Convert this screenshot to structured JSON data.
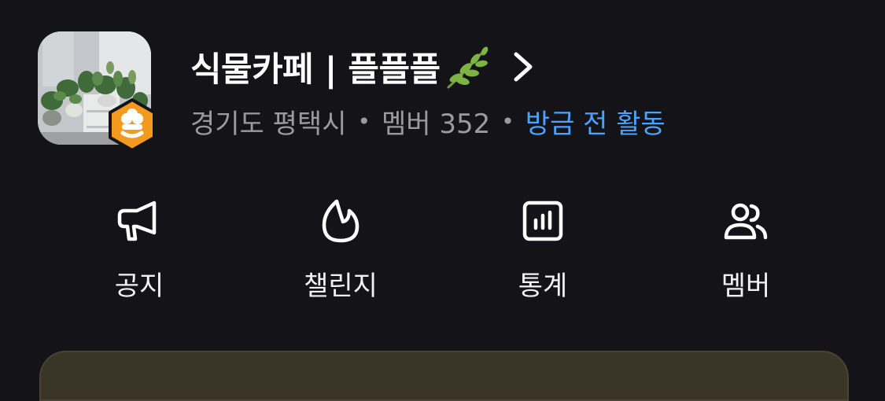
{
  "cafe": {
    "title": "식물카페 | 플플플",
    "location": "경기도 평택시",
    "members": "멤버 352",
    "activity": "방금 전 활동"
  },
  "menu": {
    "notice": "공지",
    "challenge": "챌린지",
    "stats": "통계",
    "members": "멤버"
  },
  "colors": {
    "background": "#141418",
    "accent_blue": "#4aa3ff",
    "badge_orange": "#f39a1e",
    "meta_gray": "#9a9aa0"
  },
  "icons": {
    "title_suffix": "herb-leaf-icon",
    "title_chevron": "chevron-right-icon",
    "badge": "cafe-badge-icon",
    "notice": "megaphone-icon",
    "challenge": "flame-icon",
    "stats": "bar-chart-icon",
    "members": "people-icon"
  }
}
